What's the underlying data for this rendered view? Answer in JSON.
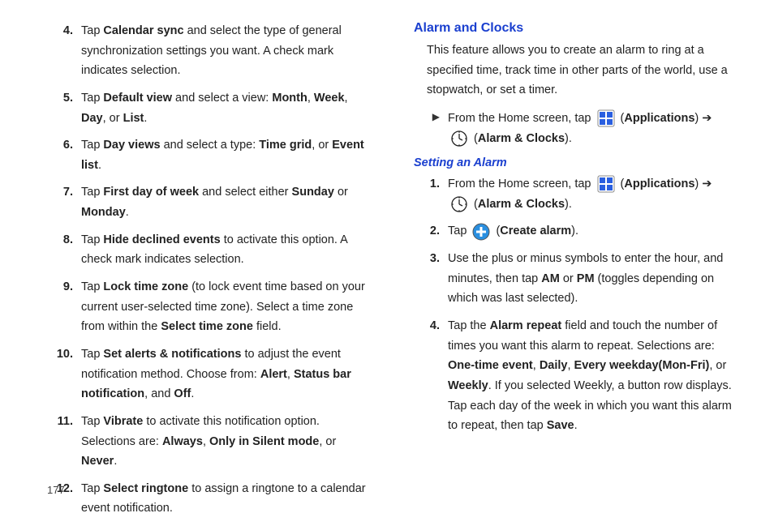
{
  "page_number": "177",
  "left_col": {
    "steps": [
      {
        "n": "4.",
        "html": "Tap <b>Calendar sync</b> and select the type of general synchronization settings you want. A check mark indicates selection."
      },
      {
        "n": "5.",
        "html": "Tap <b>Default view</b> and select a view: <b>Month</b>, <b>Week</b>, <b>Day</b>, or <b>List</b>."
      },
      {
        "n": "6.",
        "html": "Tap <b>Day views</b> and select a type: <b>Time grid</b>, or <b>Event list</b>."
      },
      {
        "n": "7.",
        "html": "Tap <b>First day of week</b> and select either <b>Sunday</b> or <b>Monday</b>."
      },
      {
        "n": "8.",
        "html": "Tap <b>Hide declined events</b> to activate this option. A check mark indicates selection."
      },
      {
        "n": "9.",
        "html": "Tap <b>Lock time zone</b> (to lock event time based on your current user-selected time zone). Select a time zone from within the <b>Select time zone</b> field."
      },
      {
        "n": "10.",
        "html": "Tap <b>Set alerts & notifications</b> to adjust the event notification method. Choose from: <b>Alert</b>, <b>Status bar notification</b>, and <b>Off</b>."
      },
      {
        "n": "11.",
        "html": "Tap <b>Vibrate</b> to activate this notification option. Selections are: <b>Always</b>, <b>Only in Silent mode</b>, or <b>Never</b>."
      },
      {
        "n": "12.",
        "html": "Tap <b>Select ringtone</b> to assign a ringtone to a calendar event notification."
      }
    ]
  },
  "right_col": {
    "h2": "Alarm and Clocks",
    "intro": "This feature allows you to create an alarm to ring at a specified time, track time in other parts of the world, use a stopwatch, or set a timer.",
    "nav_line": {
      "pre": "From the Home screen, tap ",
      "mid": " (<b>Applications</b>) ➔ ",
      "post": " (<b>Alarm & Clocks</b>)."
    },
    "h3": "Setting an Alarm",
    "steps": [
      {
        "n": "1.",
        "type": "nav",
        "pre": "From the Home screen, tap ",
        "mid": " (<b>Applications</b>) ➔ ",
        "post": " (<b>Alarm & Clocks</b>)."
      },
      {
        "n": "2.",
        "type": "plus",
        "pre": "Tap ",
        "post": " (<b>Create alarm</b>)."
      },
      {
        "n": "3.",
        "html": "Use the plus or minus symbols to enter the hour, and minutes, then tap <b>AM</b> or <b>PM</b> (toggles depending on which was last selected)."
      },
      {
        "n": "4.",
        "html": "Tap the <b>Alarm repeat</b> field and touch the number of times you want this alarm to repeat. Selections are: <b>One-time event</b>, <b>Daily</b>, <b>Every weekday(Mon-Fri)</b>, or <b>Weekly</b>. If you selected Weekly, a button row displays. Tap each day of the week in which you want this alarm to repeat, then tap <b>Save</b>."
      }
    ]
  },
  "icons": {
    "apps": "applications-grid-icon",
    "clock": "clock-icon",
    "plus": "plus-circle-icon"
  }
}
